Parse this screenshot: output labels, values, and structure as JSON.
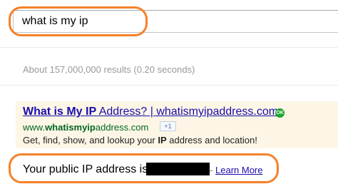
{
  "search": {
    "query": "what is my ip"
  },
  "results_stats": "About 157,000,000 results (0.20 seconds)",
  "ad": {
    "title_bold": "What is My IP",
    "title_rest": " Address? | whatismyipaddress.com",
    "ok_icon_text": "OK",
    "url_prefix": "www.",
    "url_bold": "whatismyip",
    "url_suffix": "address.com",
    "plus_one": "+1",
    "desc_prefix": "Get, find, show, and lookup your ",
    "desc_bold": "IP",
    "desc_suffix": " address and location!"
  },
  "answer": {
    "text": "Your public IP address is",
    "separator": "-",
    "link_label": "Learn More"
  },
  "colors": {
    "highlight": "#f4822a",
    "link": "#1a0dab",
    "url_green": "#006621",
    "ad_background": "#fdf6e6"
  }
}
